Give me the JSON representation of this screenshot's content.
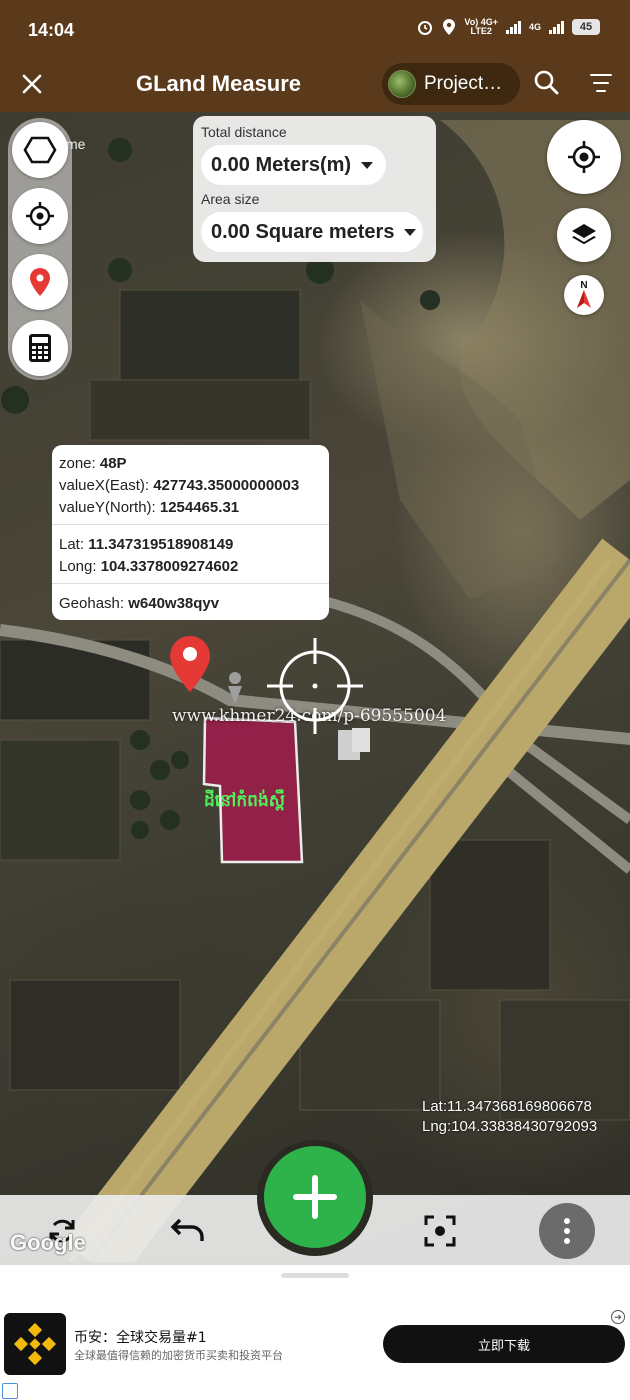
{
  "status_bar": {
    "time": "14:04",
    "network1": "Vo LTE2",
    "network1_line1": "Vo) 4G+",
    "network1_line2": "LTE2",
    "network2": "4G",
    "battery": "45"
  },
  "app_bar": {
    "title": "GLand Measure",
    "project_label": "Project…",
    "close_icon": "close-icon",
    "search_icon": "search-icon",
    "filter_icon": "filter-icon"
  },
  "map": {
    "home_label_partial": "me",
    "total_distance_label": "Total distance",
    "total_distance_value": "0.00 Meters(m)",
    "area_size_label": "Area size",
    "area_size_value": "0.00 Square meters",
    "compass_label": "N",
    "watermark": "www.khmer24.com/p-69555004",
    "parcel_label": "ដីនៅកំពង់ស្ពឺ",
    "info": {
      "zone_label": "zone:",
      "zone_value": "48P",
      "valuex_label": "valueX(East):",
      "valuex_value": "427743.35000000003",
      "valuey_label": "valueY(North):",
      "valuey_value": "1254465.31",
      "lat_label": "Lat:",
      "lat_value": "11.347319518908149",
      "long_label": "Long:",
      "long_value": "104.3378009274602",
      "geohash_label": "Geohash:",
      "geohash_value": "w640w38qyv"
    },
    "coords_lat": "Lat:11.347368169806678",
    "coords_lng": "Lng:104.33838430792093",
    "google_logo": "Google"
  },
  "ad": {
    "title": "币安：全球交易量#1",
    "subtitle": "全球最值得信赖的加密货币买卖和投资平台",
    "button": "立即下载"
  },
  "colors": {
    "app_bar": "#5a3a1a",
    "fab": "#2db34a",
    "parcel_fill": "#9a1e4a",
    "marker": "#e53935"
  }
}
